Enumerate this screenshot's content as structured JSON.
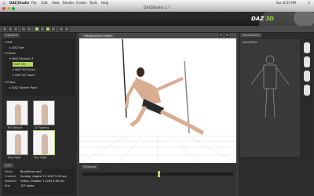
{
  "menubar": {
    "apple": "",
    "app_name": "DAZ|Studio",
    "menus": [
      "File",
      "Edit",
      "View",
      "Render",
      "Create",
      "Tools",
      "Help"
    ],
    "clock": "Sun 6:55 PM"
  },
  "window": {
    "title": "DAZ|Studio 1.7"
  },
  "banner": {
    "logo_left": "DAZ",
    "logo_right": "3D"
  },
  "left_panel": {
    "tab_label": "Content",
    "tree": [
      {
        "label": "Net"
      },
      {
        "label": "DAZ Net"
      },
      {
        "label": "Poses"
      },
      {
        "label": "DAZ Michael 3"
      },
      {
        "label": "MAT M3"
      },
      {
        "label": "MAT M3 Skins"
      },
      {
        "label": "MAT M3 Tools"
      },
      {
        "label": "Props"
      },
      {
        "label": "DAZ Starter Pack"
      }
    ],
    "thumbnails": [
      "M3 Default",
      "All Fighting",
      "Dive Fight",
      "Run Fight"
    ],
    "info_title": "Info",
    "info": {
      "labels": [
        "Name",
        "Created",
        "Modified",
        "Size"
      ],
      "values": [
        "BrestStorm.pz2",
        "Sunday, August 12 2007 5:32 pm",
        "Friday, October 1 2004 1:00 pm",
        "107 bytes"
      ]
    }
  },
  "viewport": {
    "camera_label": "Perspective View"
  },
  "right_panel": {
    "tab_label": "Parameters",
    "section": "Actor/Pose"
  },
  "bottom_panel": {
    "tab_label": "Timeline"
  }
}
